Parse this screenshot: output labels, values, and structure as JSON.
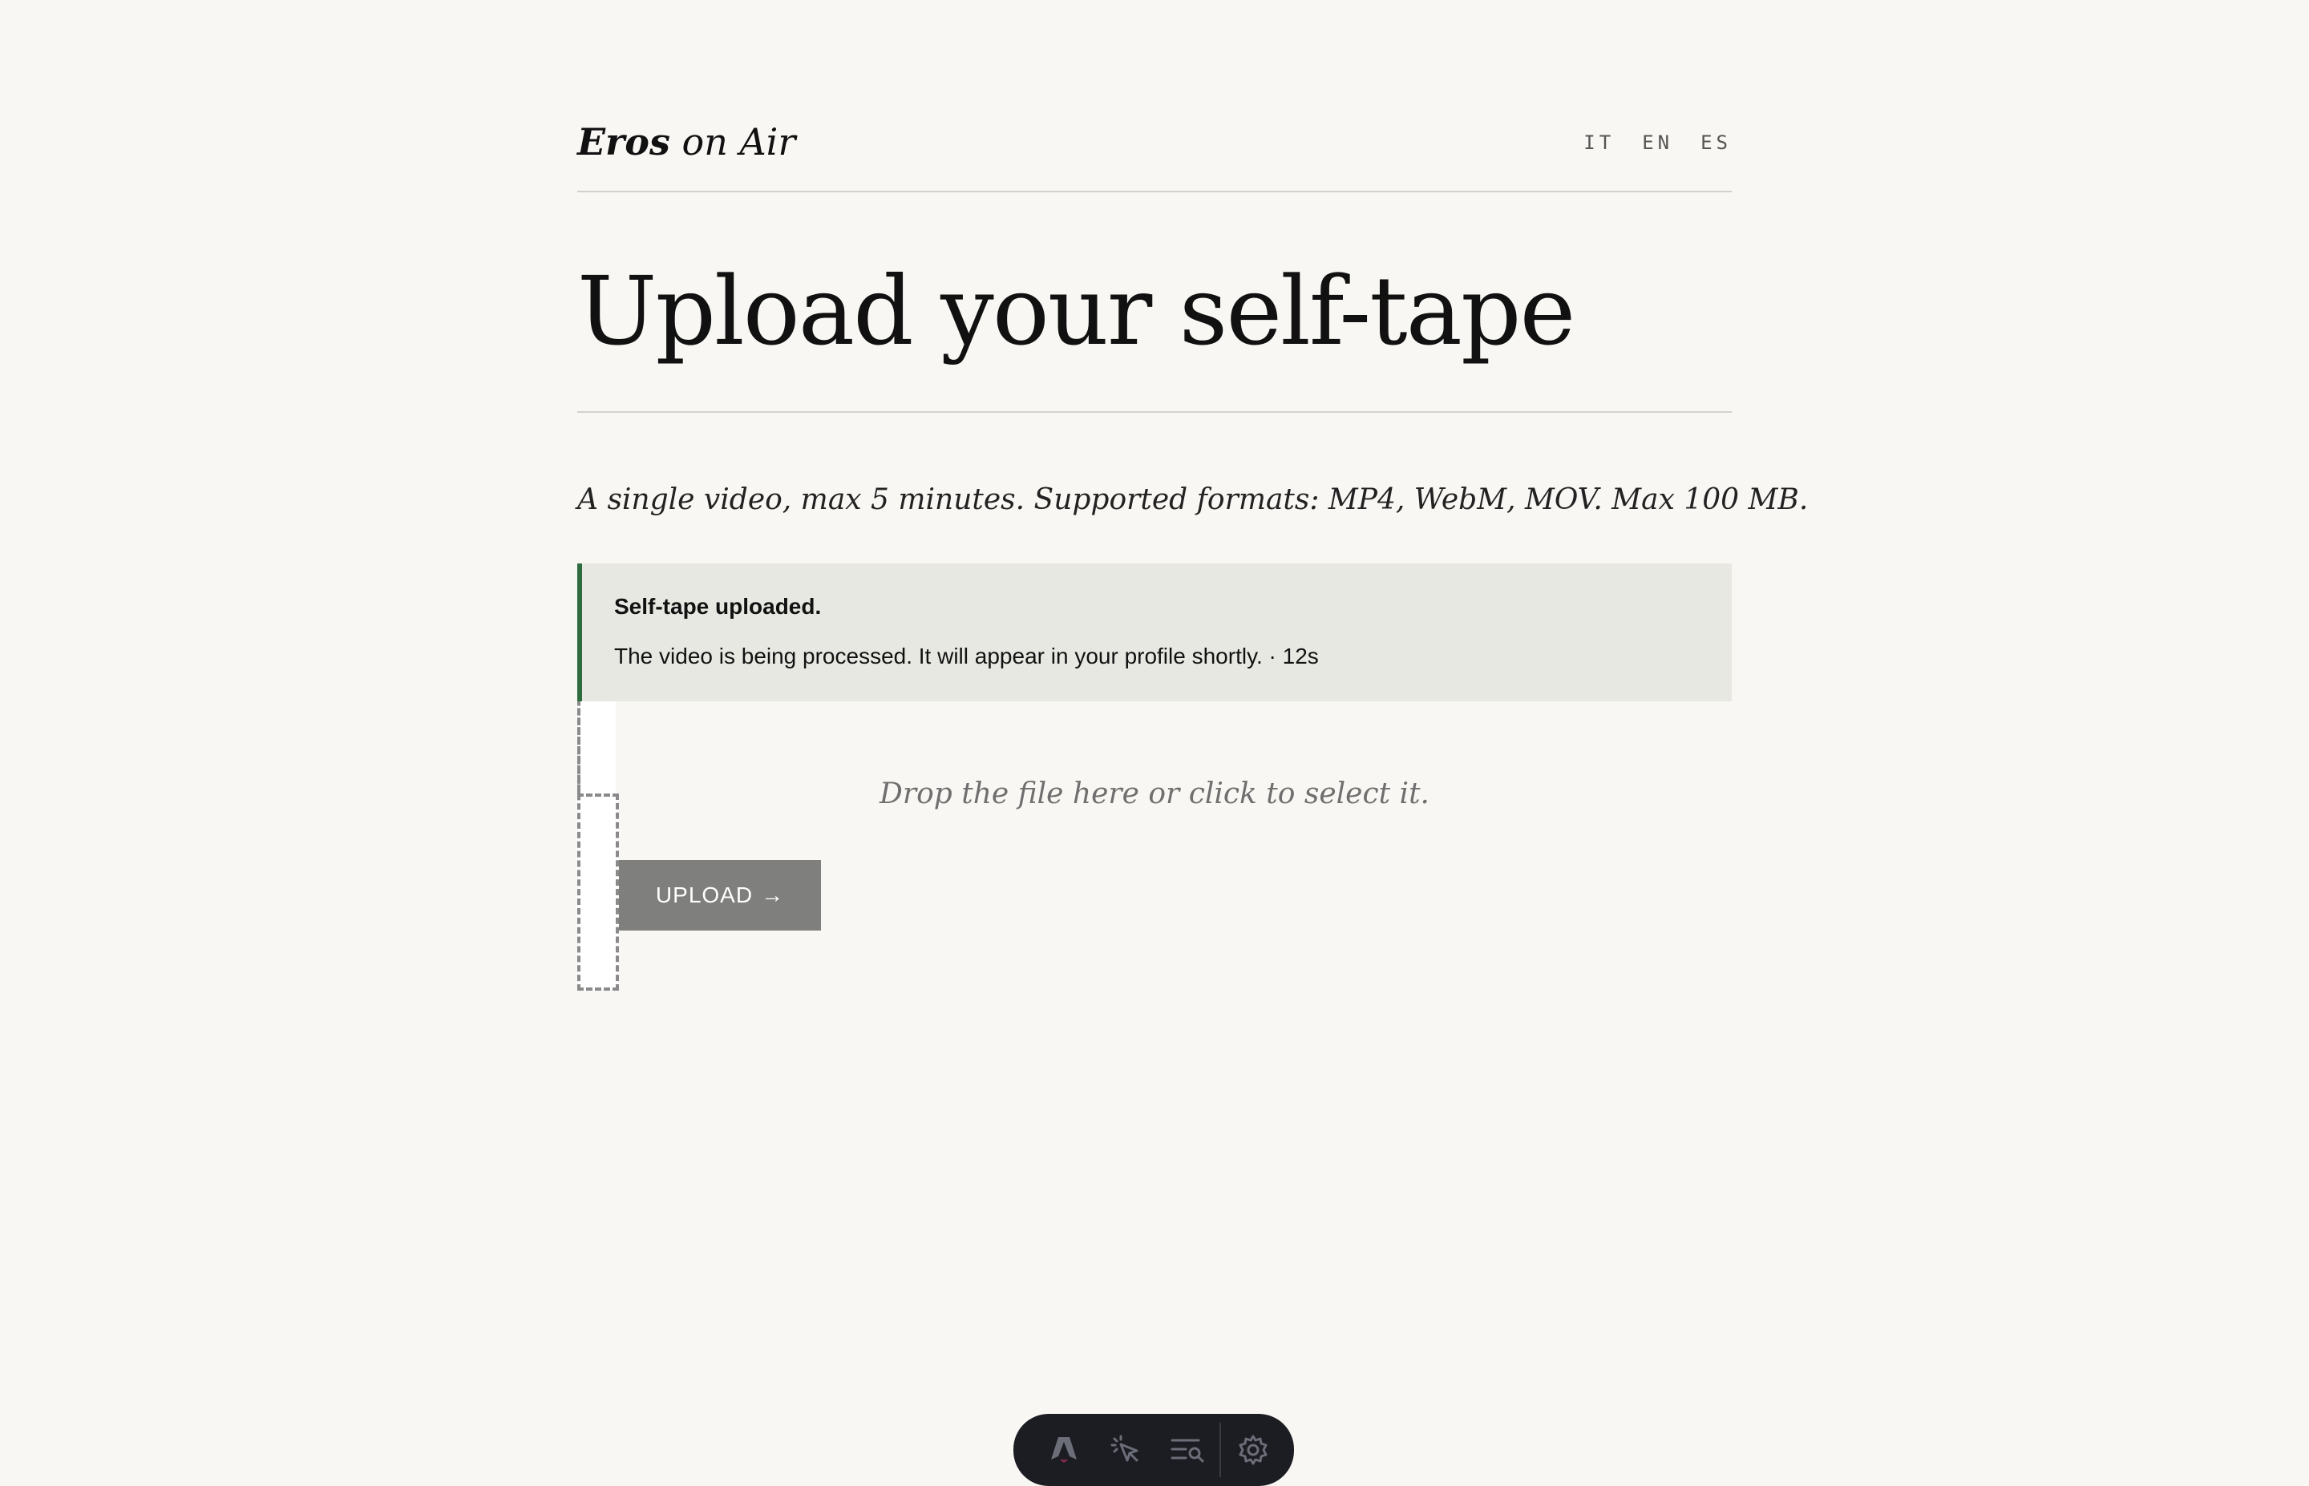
{
  "header": {
    "logo_strong": "Eros",
    "logo_light": "on Air",
    "languages": [
      "IT",
      "EN",
      "ES"
    ]
  },
  "main": {
    "title": "Upload your self-tape",
    "subtitle": "A single video, max 5 minutes. Supported formats: MP4, WebM, MOV. Max 100 MB."
  },
  "notice": {
    "title": "Self-tape uploaded.",
    "text": "The video is being processed. It will appear in your profile shortly. · 12s",
    "accent_color": "#2e6b3e"
  },
  "dropzone": {
    "hint": "Drop the file here or click to select it."
  },
  "upload_button": {
    "label": "UPLOAD",
    "arrow": "→"
  },
  "dev_toolbar": {
    "icons": [
      "astro-logo-icon",
      "inspect-cursor-icon",
      "audit-icon",
      "settings-gear-icon"
    ]
  }
}
